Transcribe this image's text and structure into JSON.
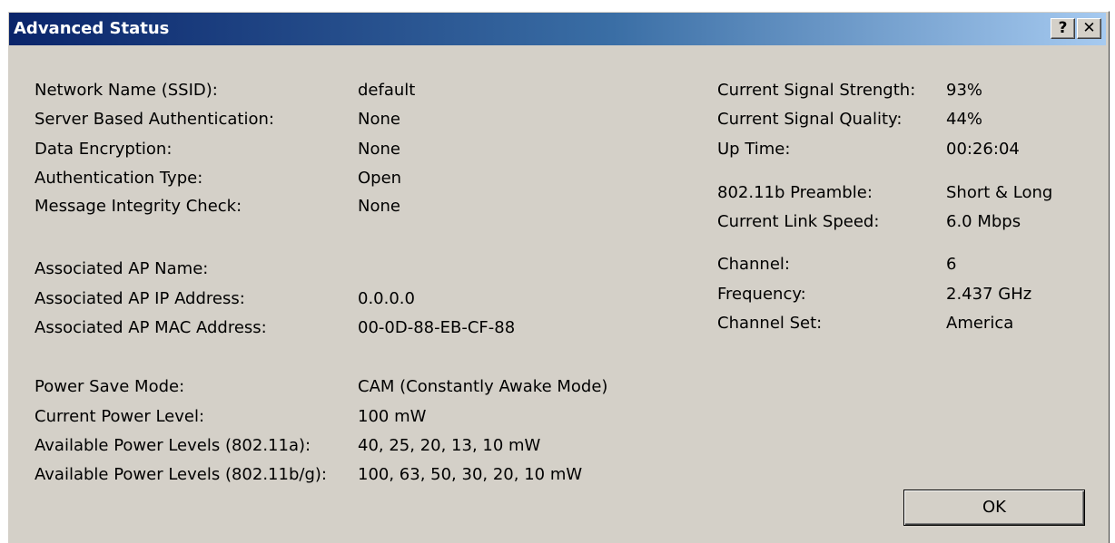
{
  "window": {
    "title": "Advanced Status",
    "help_label": "?",
    "close_label": "✕"
  },
  "left": {
    "rows": [
      {
        "label": "Network Name (SSID):",
        "value": "default"
      },
      {
        "label": "Server Based Authentication:",
        "value": "None"
      },
      {
        "label": "Data Encryption:",
        "value": "None"
      },
      {
        "label": "Authentication Type:",
        "value": "Open"
      },
      {
        "label": "Message Integrity Check:",
        "value": "None"
      },
      {
        "label": "Associated AP Name:",
        "value": ""
      },
      {
        "label": "Associated AP IP Address:",
        "value": "0.0.0.0"
      },
      {
        "label": "Associated AP MAC Address:",
        "value": "00-0D-88-EB-CF-88"
      },
      {
        "label": "Power Save Mode:",
        "value": "CAM (Constantly Awake Mode)"
      },
      {
        "label": "Current Power Level:",
        "value": "100 mW"
      },
      {
        "label": "Available Power Levels (802.11a):",
        "value": "40, 25, 20, 13, 10 mW"
      },
      {
        "label": "Available Power Levels (802.11b/g):",
        "value": "100, 63, 50, 30, 20, 10 mW"
      }
    ]
  },
  "right": {
    "rows": [
      {
        "label": "Current Signal Strength:",
        "value": "93%"
      },
      {
        "label": "Current Signal Quality:",
        "value": "44%"
      },
      {
        "label": "Up Time:",
        "value": "00:26:04"
      },
      {
        "label": "802.11b Preamble:",
        "value": "Short & Long"
      },
      {
        "label": "Current Link Speed:",
        "value": "6.0 Mbps"
      },
      {
        "label": "Channel:",
        "value": "6"
      },
      {
        "label": "Frequency:",
        "value": "2.437 GHz"
      },
      {
        "label": "Channel Set:",
        "value": "America"
      }
    ]
  },
  "buttons": {
    "ok_label": "OK"
  }
}
